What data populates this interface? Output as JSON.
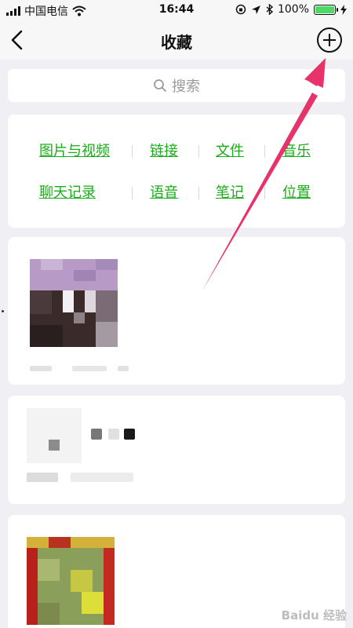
{
  "status_bar": {
    "carrier": "中国电信",
    "time": "16:44",
    "battery": "100%",
    "battery_level": 1.0
  },
  "nav": {
    "title": "收藏"
  },
  "search": {
    "placeholder": "搜索"
  },
  "categories": {
    "row1": [
      "图片与视频",
      "链接",
      "文件",
      "音乐"
    ],
    "row2": [
      "聊天记录",
      "语音",
      "笔记",
      "位置"
    ]
  },
  "colors": {
    "link_green": "#1aad19",
    "arrow": "#e8336a",
    "background": "#efeff4"
  },
  "icons": {
    "back": "chevron-left-icon",
    "add": "plus-circle-icon",
    "search": "search-icon",
    "wifi": "wifi-icon",
    "bluetooth": "bluetooth-icon",
    "location": "location-arrow-icon",
    "rotation_lock": "rotation-lock-icon"
  },
  "watermark": "Baidu 经验"
}
